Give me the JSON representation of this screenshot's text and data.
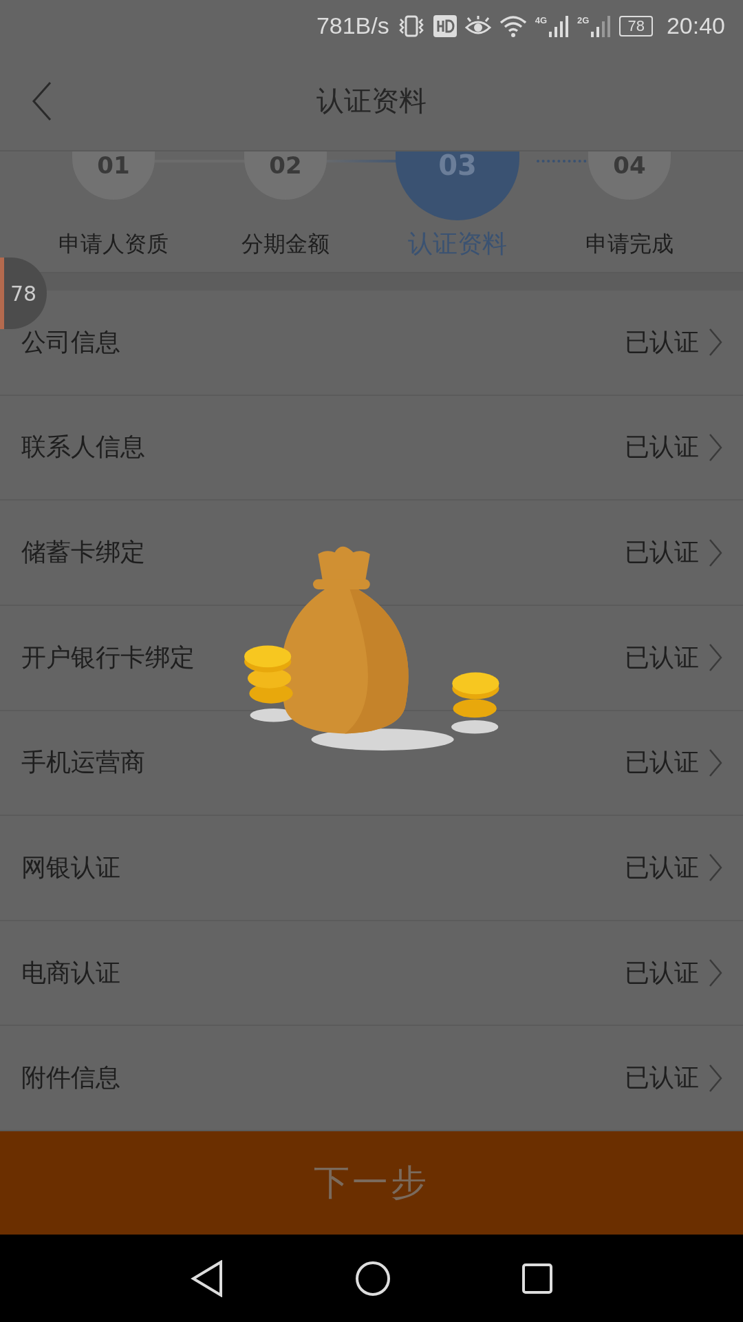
{
  "status_bar": {
    "speed": "781B/s",
    "network_1": "4G",
    "network_2": "2G",
    "battery": "78",
    "time": "20:40"
  },
  "header": {
    "title": "认证资料"
  },
  "steps": [
    {
      "number": "01",
      "label": "申请人资质",
      "selected": false
    },
    {
      "number": "02",
      "label": "分期金额",
      "selected": false
    },
    {
      "number": "03",
      "label": "认证资料",
      "selected": true
    },
    {
      "number": "04",
      "label": "申请完成",
      "selected": false
    }
  ],
  "floating_badge": "78",
  "items": [
    {
      "label": "公司信息",
      "status": "已认证"
    },
    {
      "label": "联系人信息",
      "status": "已认证"
    },
    {
      "label": "储蓄卡绑定",
      "status": "已认证"
    },
    {
      "label": "开户银行卡绑定",
      "status": "已认证"
    },
    {
      "label": "手机运营商",
      "status": "已认证"
    },
    {
      "label": "网银认证",
      "status": "已认证"
    },
    {
      "label": "电商认证",
      "status": "已认证"
    },
    {
      "label": "附件信息",
      "status": "已认证"
    }
  ],
  "next_button": "下一步"
}
